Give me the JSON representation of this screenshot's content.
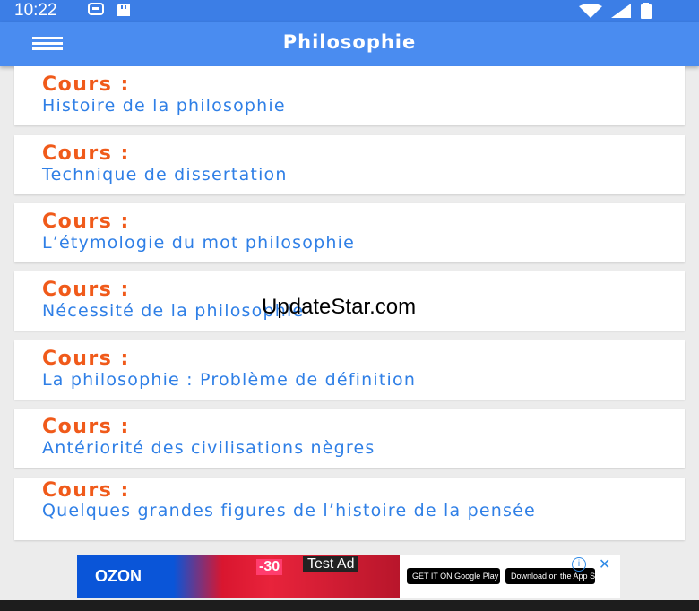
{
  "status_bar": {
    "time": "10:22",
    "left_icons": [
      "chat-bubble-icon",
      "sd-card-icon"
    ],
    "right_icons": [
      "wifi-icon",
      "signal-icon",
      "battery-icon"
    ]
  },
  "app_bar": {
    "title": "Philosophie",
    "menu_icon": "hamburger-menu-icon",
    "color": "#4a8cf0"
  },
  "colors": {
    "heading": "#f05a1a",
    "subtitle": "#2f7fe6",
    "background": "#ececec"
  },
  "courses": [
    {
      "heading": "Cours :",
      "title": "Histoire de la philosophie"
    },
    {
      "heading": "Cours :",
      "title": "Technique de dissertation"
    },
    {
      "heading": "Cours :",
      "title": "L’étymologie du mot philosophie"
    },
    {
      "heading": "Cours :",
      "title": "Nécessité de la philosophie"
    },
    {
      "heading": "Cours :",
      "title": "La philosophie : Problème de définition"
    },
    {
      "heading": "Cours :",
      "title": "Antériorité des civilisations nègres"
    },
    {
      "heading": "Cours :",
      "title": "Quelques grandes figures de l’histoire de la pensée"
    }
  ],
  "watermark": "UpdateStar.com",
  "ad": {
    "brand": "OZON",
    "sale": "-30",
    "label": "Test Ad",
    "play_store": "GET IT ON Google Play",
    "app_store": "Download on the App Store",
    "info_icon": "info-icon",
    "close_icon": "close-icon"
  }
}
